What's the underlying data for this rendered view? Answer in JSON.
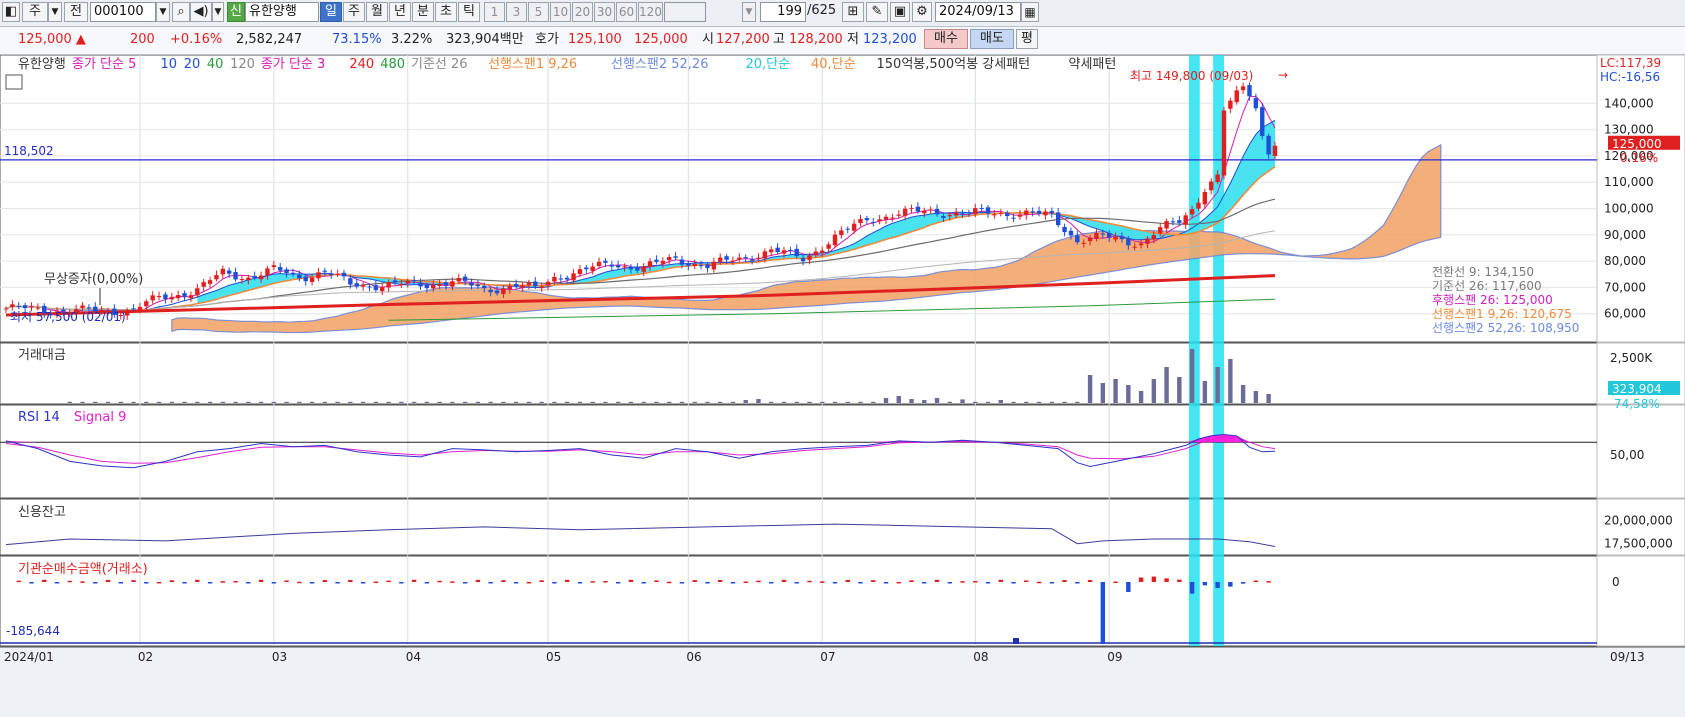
{
  "toolbar": {
    "period_select": "주",
    "prev_label": "전",
    "code": "000100",
    "badge": "신",
    "name": "유한양행",
    "periods": [
      "일",
      "주",
      "월",
      "년",
      "분",
      "초",
      "틱"
    ],
    "active_period": "일",
    "intervals": [
      "1",
      "3",
      "5",
      "10",
      "20",
      "30",
      "60",
      "120"
    ],
    "count": "199",
    "total": "/625",
    "date": "2024/09/13"
  },
  "quote": {
    "price": "125,000",
    "change": "200",
    "change_pct": "+0.16%",
    "volume": "2,582,247",
    "vol_ratio": "73.15%",
    "turnover": "3.22%",
    "amount": "323,904백만",
    "bid_label": "호가",
    "bid1": "125,100",
    "bid2": "125,000",
    "open_label": "시",
    "open": "127,200",
    "high_label": "고",
    "high": "128,200",
    "low_label": "저",
    "low": "123,200",
    "buy": "매수",
    "sell": "매도",
    "avg": "평"
  },
  "colors": {
    "up": "#e01f1f",
    "down": "#1f4fd6",
    "cloud_up": "#f2a66b",
    "cloud_down": "#3ee0f0",
    "highlight": "#22e3f2",
    "rsi": "#2b35c8",
    "signal": "#e020d0"
  },
  "chart_data": [
    {
      "type": "candlestick",
      "legend": [
        "유한양행",
        "종가 단순 5",
        "10",
        "20",
        "40",
        "120",
        "종가 단순 3",
        "240",
        "480",
        "기준선 26",
        "선행스팬1 9,26",
        "선행스팬2 52,26",
        "20,단순",
        "40,단순",
        "150억봉,500억봉 강세패턴",
        "약세패턴"
      ],
      "x_ticks": [
        "2024/01",
        "02",
        "03",
        "04",
        "05",
        "06",
        "07",
        "08",
        "09"
      ],
      "end_date": "09/13",
      "ylim": [
        50000,
        150000
      ],
      "y_ticks": [
        "140,000",
        "130,000",
        "120,000",
        "110,000",
        "100,000",
        "90,000",
        "80,000",
        "70,000",
        "60,000"
      ],
      "lc": "LC:117,39",
      "hc": "HC:-16,56",
      "hline_value": 118502,
      "hline_label": "118,502",
      "last_price": "125,000",
      "last_pct": "0.16%",
      "high_note": "최고 149,800 (09/03)",
      "low_note": "최저 57,500 (02/01)",
      "event_note": "무상증자(0,00%)",
      "info": [
        {
          "label": "전환선 9: 134,150",
          "color": "#7a7a7a"
        },
        {
          "label": "기준선 26: 117,600",
          "color": "#7a7a7a"
        },
        {
          "label": "후행스팬 26: 125,000",
          "color": "#d020c0"
        },
        {
          "label": "선행스팬1 9,26: 120,675",
          "color": "#f08a3c"
        },
        {
          "label": "선행스팬2 52,26: 108,950",
          "color": "#6b8be0"
        }
      ],
      "close_path": [
        [
          0,
          62000
        ],
        [
          12,
          61000
        ],
        [
          20,
          61500
        ],
        [
          24,
          66000
        ],
        [
          30,
          69000
        ],
        [
          34,
          75500
        ],
        [
          38,
          74000
        ],
        [
          42,
          76500
        ],
        [
          46,
          74000
        ],
        [
          50,
          76000
        ],
        [
          54,
          71000
        ],
        [
          60,
          71000
        ],
        [
          65,
          71000
        ],
        [
          70,
          72500
        ],
        [
          75,
          69000
        ],
        [
          80,
          71000
        ],
        [
          83,
          69000
        ],
        [
          86,
          74000
        ],
        [
          90,
          76000
        ],
        [
          95,
          79000
        ],
        [
          100,
          77500
        ],
        [
          105,
          81000
        ],
        [
          110,
          78000
        ],
        [
          115,
          81000
        ],
        [
          120,
          84000
        ],
        [
          125,
          81000
        ],
        [
          130,
          89000
        ],
        [
          135,
          96000
        ],
        [
          140,
          98000
        ],
        [
          145,
          99000
        ],
        [
          150,
          98000
        ],
        [
          155,
          98500
        ],
        [
          160,
          98000
        ],
        [
          164,
          97000
        ],
        [
          168,
          88000
        ],
        [
          172,
          89000
        ],
        [
          175,
          88000
        ],
        [
          178,
          87000
        ],
        [
          181,
          92000
        ],
        [
          184,
          95000
        ],
        [
          186,
          100000
        ],
        [
          188,
          108000
        ],
        [
          190,
          112000
        ],
        [
          191,
          137000
        ],
        [
          192,
          140000
        ],
        [
          193,
          143000
        ],
        [
          194,
          146000
        ],
        [
          195,
          144000
        ],
        [
          196,
          139000
        ],
        [
          197,
          128000
        ],
        [
          198,
          122000
        ],
        [
          199,
          125000
        ]
      ]
    },
    {
      "type": "bar",
      "title": "거래대금",
      "ytick": "2,500K",
      "last": "323,904",
      "last_pct": "74,58%",
      "spikes": [
        [
          170,
          1400
        ],
        [
          172,
          1000
        ],
        [
          174,
          1200
        ],
        [
          176,
          900
        ],
        [
          178,
          600
        ],
        [
          180,
          1200
        ],
        [
          182,
          1800
        ],
        [
          184,
          1300
        ],
        [
          185,
          1100
        ],
        [
          186,
          2700
        ],
        [
          187,
          1000
        ],
        [
          188,
          1100
        ],
        [
          189,
          1500
        ],
        [
          190,
          1800
        ],
        [
          191,
          2600
        ],
        [
          192,
          2200
        ],
        [
          193,
          1300
        ],
        [
          194,
          900
        ],
        [
          195,
          700
        ],
        [
          196,
          600
        ],
        [
          197,
          500
        ],
        [
          198,
          450
        ],
        [
          199,
          330
        ]
      ],
      "moderate": [
        [
          116,
          150
        ],
        [
          118,
          200
        ],
        [
          138,
          250
        ],
        [
          140,
          350
        ],
        [
          142,
          200
        ],
        [
          144,
          150
        ],
        [
          146,
          250
        ],
        [
          150,
          180
        ],
        [
          156,
          150
        ]
      ]
    },
    {
      "type": "line",
      "title": "RSI 14",
      "signal_title": "Signal 9",
      "ytick": "50,00",
      "ylim": [
        0,
        100
      ],
      "level": 70,
      "rsi": [
        [
          0,
          72
        ],
        [
          5,
          60
        ],
        [
          10,
          40
        ],
        [
          15,
          33
        ],
        [
          20,
          30
        ],
        [
          25,
          40
        ],
        [
          30,
          55
        ],
        [
          35,
          60
        ],
        [
          40,
          68
        ],
        [
          45,
          63
        ],
        [
          50,
          65
        ],
        [
          55,
          55
        ],
        [
          60,
          50
        ],
        [
          65,
          47
        ],
        [
          70,
          60
        ],
        [
          75,
          58
        ],
        [
          80,
          55
        ],
        [
          85,
          57
        ],
        [
          90,
          60
        ],
        [
          95,
          50
        ],
        [
          100,
          45
        ],
        [
          105,
          60
        ],
        [
          110,
          55
        ],
        [
          115,
          45
        ],
        [
          120,
          55
        ],
        [
          125,
          60
        ],
        [
          130,
          63
        ],
        [
          135,
          65
        ],
        [
          140,
          72
        ],
        [
          145,
          70
        ],
        [
          150,
          73
        ],
        [
          155,
          70
        ],
        [
          160,
          65
        ],
        [
          165,
          60
        ],
        [
          168,
          38
        ],
        [
          170,
          32
        ],
        [
          175,
          42
        ],
        [
          180,
          52
        ],
        [
          183,
          60
        ],
        [
          185,
          65
        ],
        [
          187,
          75
        ],
        [
          189,
          80
        ],
        [
          191,
          82
        ],
        [
          193,
          80
        ],
        [
          195,
          62
        ],
        [
          197,
          55
        ],
        [
          199,
          56
        ]
      ],
      "signal": [
        [
          0,
          68
        ],
        [
          5,
          62
        ],
        [
          10,
          50
        ],
        [
          15,
          40
        ],
        [
          20,
          37
        ],
        [
          25,
          38
        ],
        [
          30,
          46
        ],
        [
          35,
          55
        ],
        [
          40,
          62
        ],
        [
          45,
          63
        ],
        [
          50,
          63
        ],
        [
          55,
          58
        ],
        [
          60,
          53
        ],
        [
          65,
          50
        ],
        [
          70,
          55
        ],
        [
          75,
          57
        ],
        [
          80,
          56
        ],
        [
          85,
          56
        ],
        [
          90,
          58
        ],
        [
          95,
          55
        ],
        [
          100,
          50
        ],
        [
          105,
          55
        ],
        [
          110,
          55
        ],
        [
          115,
          50
        ],
        [
          120,
          52
        ],
        [
          125,
          57
        ],
        [
          130,
          60
        ],
        [
          135,
          63
        ],
        [
          140,
          69
        ],
        [
          145,
          70
        ],
        [
          150,
          71
        ],
        [
          155,
          70
        ],
        [
          160,
          67
        ],
        [
          165,
          63
        ],
        [
          168,
          50
        ],
        [
          170,
          45
        ],
        [
          175,
          44
        ],
        [
          180,
          48
        ],
        [
          183,
          55
        ],
        [
          185,
          60
        ],
        [
          187,
          68
        ],
        [
          189,
          74
        ],
        [
          191,
          78
        ],
        [
          193,
          78
        ],
        [
          195,
          70
        ],
        [
          197,
          63
        ],
        [
          199,
          60
        ]
      ]
    },
    {
      "type": "line",
      "title": "신용잔고",
      "y_ticks": [
        "20,000,000",
        "17,500,000"
      ],
      "ylim": [
        16500000,
        21000000
      ],
      "values": [
        [
          0,
          17400000
        ],
        [
          10,
          18000000
        ],
        [
          25,
          17800000
        ],
        [
          45,
          18600000
        ],
        [
          60,
          19000000
        ],
        [
          75,
          19300000
        ],
        [
          90,
          19000000
        ],
        [
          110,
          19300000
        ],
        [
          130,
          19600000
        ],
        [
          150,
          19300000
        ],
        [
          164,
          19100000
        ],
        [
          166,
          18300000
        ],
        [
          168,
          17500000
        ],
        [
          172,
          17800000
        ],
        [
          180,
          18000000
        ],
        [
          190,
          18000000
        ],
        [
          195,
          17700000
        ],
        [
          199,
          17200000
        ]
      ]
    },
    {
      "type": "bar",
      "title": "기관순매수금액(거래소)",
      "y_ticks": [
        "0"
      ],
      "min_label": "-185,644",
      "ylim": [
        -185644,
        40000
      ],
      "values": [
        [
          172,
          -185644
        ],
        [
          176,
          -30000
        ],
        [
          178,
          15000
        ],
        [
          180,
          18000
        ],
        [
          182,
          12000
        ],
        [
          184,
          8000
        ],
        [
          185,
          -22000
        ],
        [
          186,
          -35000
        ],
        [
          187,
          -15000
        ],
        [
          188,
          -10000
        ],
        [
          189,
          -12000
        ],
        [
          190,
          -18000
        ],
        [
          191,
          -20000
        ],
        [
          192,
          -14000
        ],
        [
          193,
          -8000
        ],
        [
          194,
          -5000
        ],
        [
          195,
          4000
        ],
        [
          196,
          5000
        ],
        [
          197,
          6000
        ],
        [
          198,
          3000
        ],
        [
          199,
          2000
        ]
      ]
    }
  ]
}
